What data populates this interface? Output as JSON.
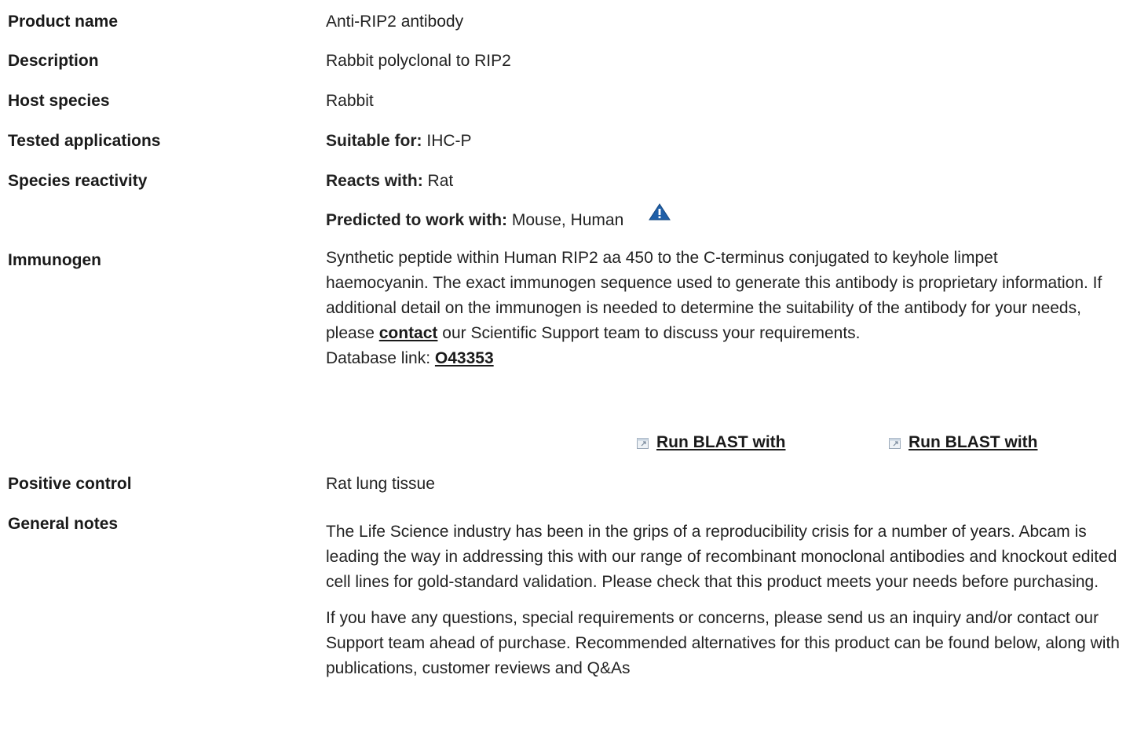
{
  "rows": {
    "product_name": {
      "label": "Product name",
      "value": "Anti-RIP2 antibody"
    },
    "description": {
      "label": "Description",
      "value": "Rabbit polyclonal to RIP2"
    },
    "host_species": {
      "label": "Host species",
      "value": "Rabbit"
    },
    "tested_applications": {
      "label": "Tested applications",
      "prefix": "Suitable for:",
      "value": "IHC-P"
    },
    "species_reactivity": {
      "label": "Species reactivity",
      "prefix": "Reacts with:",
      "value": "Rat",
      "predicted_prefix": "Predicted to work with:",
      "predicted_value": "Mouse, Human"
    },
    "immunogen": {
      "label": "Immunogen",
      "text_before_link": "Synthetic peptide within Human RIP2 aa 450 to the C-terminus conjugated to keyhole limpet haemocyanin. The exact immunogen sequence used to generate this antibody is proprietary information. If additional detail on the immunogen is needed to determine the suitability of the antibody for your needs, please",
      "link_text": "contact",
      "text_after_link": "our Scientific Support team to discuss your requirements.",
      "db_prefix": "Database link:",
      "db_link": "O43353",
      "blast_1": "Run BLAST with",
      "blast_2": "Run BLAST with"
    },
    "positive_control": {
      "label": "Positive control",
      "value": "Rat lung tissue"
    },
    "general_notes": {
      "label": "General notes",
      "para1": "The Life Science industry has been in the grips of a reproducibility crisis for a number of years. Abcam is leading the way in addressing this with our range of recombinant monoclonal antibodies and knockout edited cell lines for gold-standard validation. Please check that this product meets your needs before purchasing.",
      "para2": "If you have any questions, special requirements or concerns, please send us an inquiry and/or contact our Support team ahead of purchase. Recommended alternatives for this product can be found below, along with publications, customer reviews and Q&As"
    }
  },
  "colors": {
    "warning_icon": "#1f5fa8",
    "link": "#1a1a1a"
  },
  "icons": {
    "warning": "warning-triangle-icon",
    "external": "external-link-icon"
  }
}
